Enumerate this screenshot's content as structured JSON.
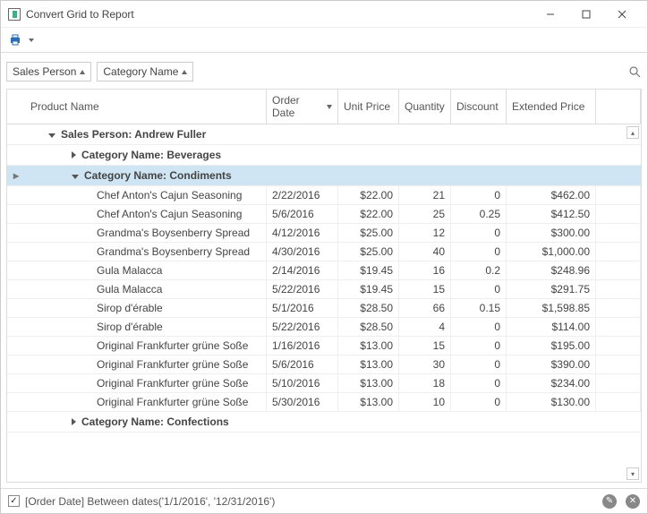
{
  "window": {
    "title": "Convert Grid to Report"
  },
  "group_pills": [
    {
      "label": "Sales Person"
    },
    {
      "label": "Category Name"
    }
  ],
  "columns": {
    "product": "Product Name",
    "date": "Order Date",
    "price": "Unit Price",
    "qty": "Quantity",
    "disc": "Discount",
    "ext": "Extended Price"
  },
  "groups": {
    "sales_person": "Sales Person: Andrew Fuller",
    "cat_beverages": "Category Name: Beverages",
    "cat_condiments": "Category Name: Condiments",
    "cat_confections": "Category Name: Confections"
  },
  "rows": [
    {
      "product": "Chef Anton's Cajun Seasoning",
      "date": "2/22/2016",
      "price": "$22.00",
      "qty": "21",
      "disc": "0",
      "ext": "$462.00"
    },
    {
      "product": "Chef Anton's Cajun Seasoning",
      "date": "5/6/2016",
      "price": "$22.00",
      "qty": "25",
      "disc": "0.25",
      "ext": "$412.50"
    },
    {
      "product": "Grandma's Boysenberry Spread",
      "date": "4/12/2016",
      "price": "$25.00",
      "qty": "12",
      "disc": "0",
      "ext": "$300.00"
    },
    {
      "product": "Grandma's Boysenberry Spread",
      "date": "4/30/2016",
      "price": "$25.00",
      "qty": "40",
      "disc": "0",
      "ext": "$1,000.00"
    },
    {
      "product": "Gula Malacca",
      "date": "2/14/2016",
      "price": "$19.45",
      "qty": "16",
      "disc": "0.2",
      "ext": "$248.96"
    },
    {
      "product": "Gula Malacca",
      "date": "5/22/2016",
      "price": "$19.45",
      "qty": "15",
      "disc": "0",
      "ext": "$291.75"
    },
    {
      "product": "Sirop d'érable",
      "date": "5/1/2016",
      "price": "$28.50",
      "qty": "66",
      "disc": "0.15",
      "ext": "$1,598.85"
    },
    {
      "product": "Sirop d'érable",
      "date": "5/22/2016",
      "price": "$28.50",
      "qty": "4",
      "disc": "0",
      "ext": "$114.00"
    },
    {
      "product": "Original Frankfurter grüne Soße",
      "date": "1/16/2016",
      "price": "$13.00",
      "qty": "15",
      "disc": "0",
      "ext": "$195.00"
    },
    {
      "product": "Original Frankfurter grüne Soße",
      "date": "5/6/2016",
      "price": "$13.00",
      "qty": "30",
      "disc": "0",
      "ext": "$390.00"
    },
    {
      "product": "Original Frankfurter grüne Soße",
      "date": "5/10/2016",
      "price": "$13.00",
      "qty": "18",
      "disc": "0",
      "ext": "$234.00"
    },
    {
      "product": "Original Frankfurter grüne Soße",
      "date": "5/30/2016",
      "price": "$13.00",
      "qty": "10",
      "disc": "0",
      "ext": "$130.00"
    }
  ],
  "filter": {
    "checked_glyph": "✓",
    "text": "[Order Date] Between dates('1/1/2016', '12/31/2016')",
    "edit_glyph": "✎",
    "close_glyph": "✕"
  }
}
